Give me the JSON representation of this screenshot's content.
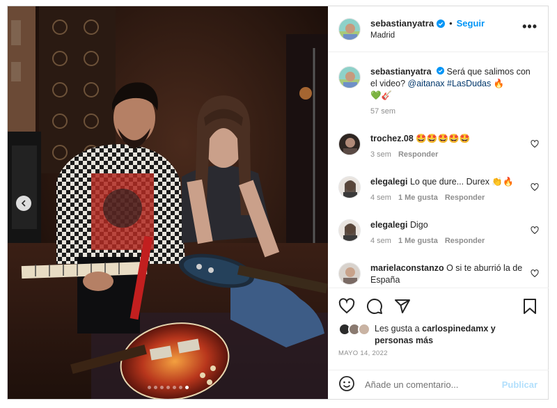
{
  "post": {
    "media": {
      "prev_label": "Previous",
      "dots": 7,
      "active_dot": 6
    },
    "header": {
      "username": "sebastianyatra",
      "separator": "•",
      "follow_label": "Seguir",
      "location": "Madrid",
      "more_label": "•••"
    },
    "caption": {
      "username": "sebastianyatra",
      "text_1": "Será que salimos con el video?",
      "mention": "@aitanax",
      "hashtag": "#LasDudas",
      "emoji_1": "🔥",
      "emoji_line": "💚🎸",
      "time": "57 sem"
    },
    "comments": [
      {
        "username": "trochez.08",
        "text": "🤩🤩🤩🤩🤩",
        "time": "3 sem",
        "likes": "",
        "reply": "Responder"
      },
      {
        "username": "elegalegi",
        "text": "Lo que dure... Durex 👏🔥",
        "time": "4 sem",
        "likes": "1 Me gusta",
        "reply": "Responder"
      },
      {
        "username": "elegalegi",
        "text": "Digo",
        "time": "4 sem",
        "likes": "1 Me gusta",
        "reply": "Responder"
      },
      {
        "username": "marielaconstanzo",
        "text": "O si te aburrió la de España",
        "time": "",
        "likes": "",
        "reply": ""
      }
    ],
    "likes": {
      "prefix": "Les gusta a",
      "user": "carlospinedamx",
      "suffix": "y personas más"
    },
    "date": "MAYO 14, 2022",
    "composer": {
      "placeholder": "Añade un comentario...",
      "publish_label": "Publicar"
    },
    "colors": {
      "accent": "#0095f6",
      "verified": "#0095f6",
      "publish_disabled": "#b2dffc",
      "muted": "#8e8e8e"
    },
    "icons": [
      "chevron-left-icon",
      "verified-icon",
      "more-icon",
      "heart-icon",
      "comment-icon",
      "share-icon",
      "bookmark-icon",
      "emoji-icon"
    ]
  }
}
